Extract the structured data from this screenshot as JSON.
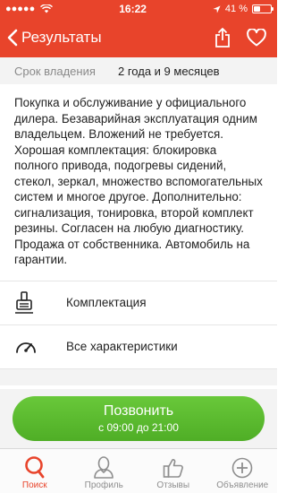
{
  "status_bar": {
    "time": "16:22",
    "battery": "41 %",
    "battery_level": 0.41
  },
  "nav": {
    "back_label": "Результаты"
  },
  "ownership": {
    "label": "Срок владения",
    "value": "2 года и 9 месяцев"
  },
  "description": "Покупка и обслуживание у официального дилера. Безаварийная эксплуатация одним владельцем. Вложений не требуется. Хорошая комплектация: блокировка полного привода, подогревы сидений, стекол, зеркал, множество вспомогательных систем и многое другое. Дополнительно: сигнализация, тонировка, второй комплект резины. Согласен на любую диагностику. Продажа от собственника. Автомобиль на гарантии.",
  "links": [
    {
      "label": "Комплектация",
      "icon": "equipment-icon"
    },
    {
      "label": "Все характеристики",
      "icon": "gauge-icon"
    }
  ],
  "call": {
    "title": "Позвонить",
    "hours": "с 09:00 до 21:00"
  },
  "tabs": [
    {
      "label": "Поиск",
      "icon": "search-icon",
      "active": true
    },
    {
      "label": "Профиль",
      "icon": "profile-icon",
      "active": false
    },
    {
      "label": "Отзывы",
      "icon": "thumbs-up-icon",
      "active": false
    },
    {
      "label": "Объявление",
      "icon": "add-icon",
      "active": false
    }
  ],
  "colors": {
    "accent": "#e8442b",
    "call_green": "#5bbb2f",
    "inactive_gray": "#8e8e8e"
  }
}
